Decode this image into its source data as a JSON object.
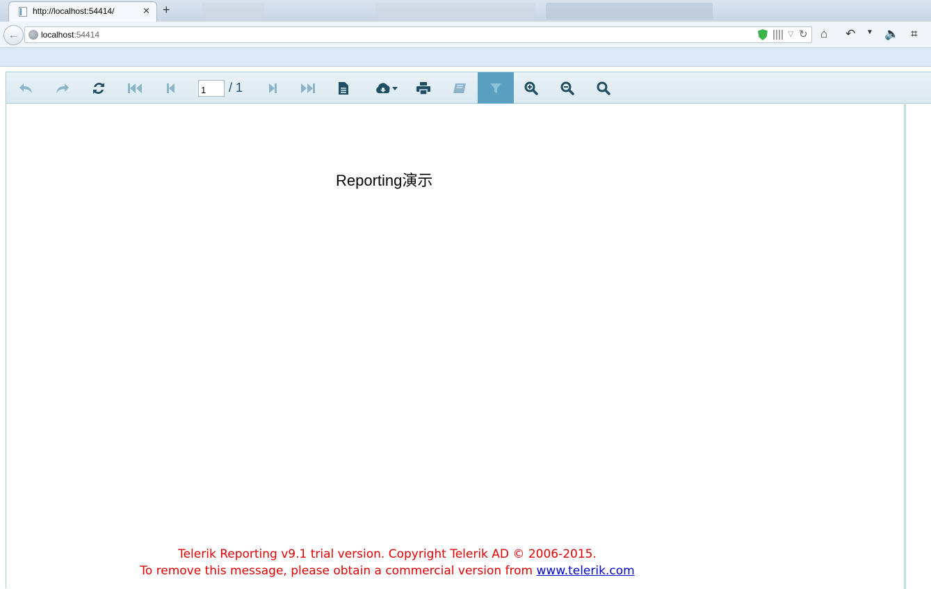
{
  "browser": {
    "tab_title": "http://localhost:54414/",
    "url_host": "localhost",
    "url_port": ":54414"
  },
  "icons": {
    "tab_close": "close-icon",
    "new_tab": "plus-icon",
    "back": "back-arrow-icon",
    "home": "home-icon",
    "undo": "undo-icon",
    "volume": "volume-icon",
    "crop": "crop-icon"
  },
  "viewer": {
    "toolbar": {
      "page_current": "1",
      "page_total": "/ 1",
      "buttons": [
        "back",
        "forward",
        "refresh",
        "first-page",
        "previous-page",
        "next-page",
        "last-page",
        "toggle-document-map",
        "export",
        "print",
        "print-preview",
        "parameters",
        "zoom-in",
        "zoom-out",
        "zoom-fit"
      ]
    },
    "report": {
      "title": "Reporting演示",
      "watermark_line1": "Telerik Reporting v9.1 trial version. Copyright Telerik AD © 2006-2015.",
      "watermark_line2": "To remove this message, please obtain a commercial version from ",
      "watermark_link": "www.telerik.com"
    }
  },
  "colors": {
    "toolbar_icon_dark": "#1d4e63",
    "toolbar_icon_dim": "#8bb3c9",
    "toolbar_active": "#5a9fbf",
    "watermark": "#e00000",
    "link": "#0000cc"
  }
}
